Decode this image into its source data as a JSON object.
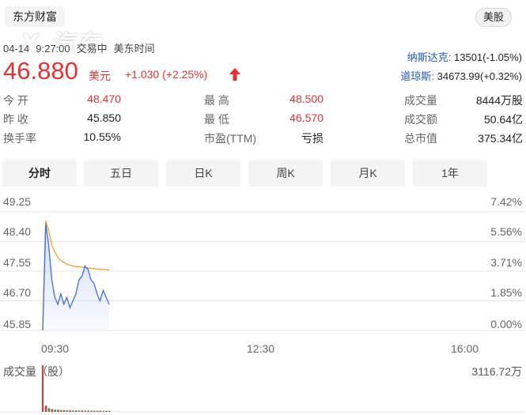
{
  "header": {
    "stock_name": "东方财富",
    "market_badge": "美股",
    "watermark_text": "汽车之家"
  },
  "status": {
    "date": "04-14",
    "time": "9:27:00",
    "trade_state": "交易中",
    "timezone": "美东时间"
  },
  "quote": {
    "price": "46.880",
    "unit": "美元",
    "change": "+1.030 (+2.25%)",
    "direction_icon": "up-arrow-icon",
    "up_color": "#e93030"
  },
  "indices": [
    {
      "name": "纳斯达克:",
      "value": "13501(-1.05%)"
    },
    {
      "name": "道琼斯:",
      "value": "34673.99(+0.32%)"
    }
  ],
  "stats": {
    "open_label": "今  开",
    "open": "48.470",
    "high_label": "最  高",
    "high": "48.500",
    "volume_label": "成交量",
    "volume": "8444万股",
    "prev_close_label": "昨  收",
    "prev_close": "45.850",
    "low_label": "最  低",
    "low": "46.570",
    "turnover_label": "成交额",
    "turnover": "50.64亿",
    "turnover_rate_label": "换手率",
    "turnover_rate": "10.55%",
    "pe_label": "市盈(TTM)",
    "pe": "亏损",
    "market_cap_label": "总市值",
    "market_cap": "375.34亿"
  },
  "tabs": [
    "分时",
    "五日",
    "日K",
    "周K",
    "月K",
    "1年"
  ],
  "active_tab": 0,
  "chart": {
    "y_left": [
      "49.25",
      "48.40",
      "47.55",
      "46.70",
      "45.85"
    ],
    "y_right": [
      "7.42%",
      "5.56%",
      "3.71%",
      "1.85%",
      "0.00%"
    ],
    "x_labels": [
      "09:30",
      "12:30",
      "16:00"
    ],
    "volume_title": "成交量（股）",
    "volume_max": "3116.72万",
    "price_line_color": "#3d6fd6",
    "avg_line_color": "#f0a020"
  },
  "chart_data": {
    "type": "line",
    "ylim": [
      45.85,
      49.25
    ],
    "series": [
      {
        "values": [
          45.85,
          48.9,
          48.3,
          47.3,
          46.8,
          46.6,
          46.9,
          46.6,
          46.8,
          46.5,
          46.7,
          46.9,
          47.3,
          47.4,
          47.7,
          47.6,
          47.3,
          47.2,
          46.9,
          46.7,
          47.0,
          46.8,
          46.6
        ]
      },
      {
        "values": [
          45.85,
          49.0,
          48.7,
          48.3,
          48.1,
          47.95,
          47.85,
          47.8,
          47.75,
          47.72,
          47.7,
          47.68,
          47.68,
          47.66,
          47.65,
          47.64,
          47.63,
          47.62,
          47.61,
          47.6,
          47.6,
          47.59,
          47.58
        ]
      }
    ],
    "volume": [
      3116.72,
      400,
      250,
      180,
      150,
      130,
      120,
      110,
      100,
      95,
      90,
      90,
      85,
      85,
      80,
      80,
      80,
      75,
      75,
      75,
      70,
      70,
      70
    ]
  }
}
